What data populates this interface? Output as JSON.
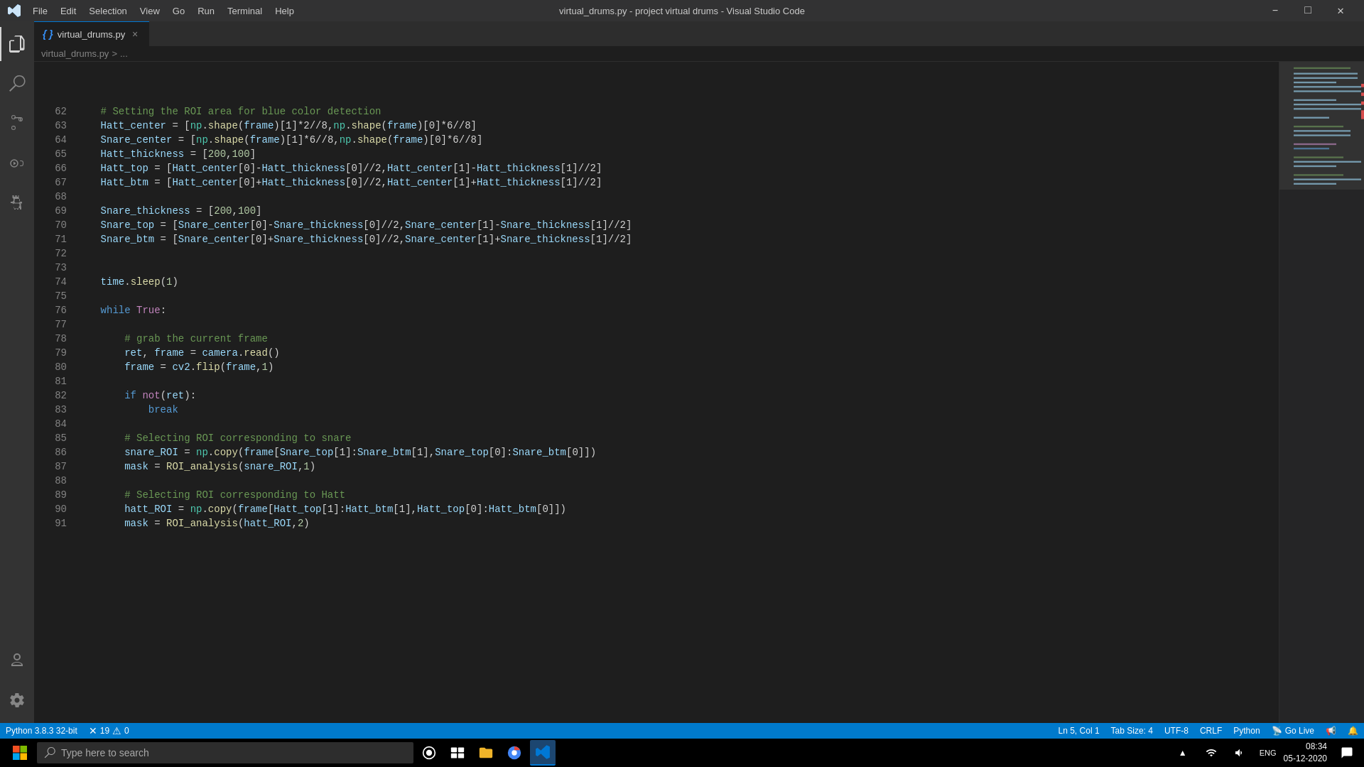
{
  "titlebar": {
    "title": "virtual_drums.py - project virtual drums - Visual Studio Code",
    "menu": [
      "File",
      "Edit",
      "Selection",
      "View",
      "Go",
      "Run",
      "Terminal",
      "Help"
    ]
  },
  "tab": {
    "filename": "virtual_drums.py",
    "close_label": "×"
  },
  "breadcrumb": {
    "path": "virtual_drums.py",
    "separator": ">",
    "more": "..."
  },
  "statusbar": {
    "python_version": "Python 3.8.3 32-bit",
    "errors": "19",
    "warnings": "0",
    "position": "Ln 5, Col 1",
    "tab_size": "Tab Size: 4",
    "encoding": "UTF-8",
    "line_ending": "CRLF",
    "language": "Python",
    "go_live": "Go Live"
  },
  "taskbar": {
    "search_placeholder": "Type here to search",
    "time": "08:34",
    "date": "05-12-2020"
  },
  "code_lines": [
    {
      "num": "62",
      "tokens": [
        {
          "t": "comment",
          "v": "    # Setting the ROI area for blue color detection"
        }
      ]
    },
    {
      "num": "63",
      "tokens": [
        {
          "t": "var",
          "v": "    Hatt_center"
        },
        {
          "t": "op",
          "v": " = ["
        },
        {
          "t": "builtin",
          "v": "np"
        },
        {
          "t": "op",
          "v": "."
        },
        {
          "t": "fn",
          "v": "shape"
        },
        {
          "t": "op",
          "v": "("
        },
        {
          "t": "var",
          "v": "frame"
        },
        {
          "t": "op",
          "v": ")[1]*2//8,"
        },
        {
          "t": "builtin",
          "v": "np"
        },
        {
          "t": "op",
          "v": "."
        },
        {
          "t": "fn",
          "v": "shape"
        },
        {
          "t": "op",
          "v": "("
        },
        {
          "t": "var",
          "v": "frame"
        },
        {
          "t": "op",
          "v": ")[0]*6//8]"
        }
      ]
    },
    {
      "num": "64",
      "tokens": [
        {
          "t": "var",
          "v": "    Snare_center"
        },
        {
          "t": "op",
          "v": " = ["
        },
        {
          "t": "builtin",
          "v": "np"
        },
        {
          "t": "op",
          "v": "."
        },
        {
          "t": "fn",
          "v": "shape"
        },
        {
          "t": "op",
          "v": "("
        },
        {
          "t": "var",
          "v": "frame"
        },
        {
          "t": "op",
          "v": ")[1]*6//8,"
        },
        {
          "t": "builtin",
          "v": "np"
        },
        {
          "t": "op",
          "v": "."
        },
        {
          "t": "fn",
          "v": "shape"
        },
        {
          "t": "op",
          "v": "("
        },
        {
          "t": "var",
          "v": "frame"
        },
        {
          "t": "op",
          "v": ")[0]*6//8]"
        }
      ]
    },
    {
      "num": "65",
      "tokens": [
        {
          "t": "var",
          "v": "    Hatt_thickness"
        },
        {
          "t": "op",
          "v": " = ["
        },
        {
          "t": "num",
          "v": "200"
        },
        {
          "t": "op",
          "v": ","
        },
        {
          "t": "num",
          "v": "100"
        },
        {
          "t": "op",
          "v": "]"
        }
      ]
    },
    {
      "num": "66",
      "tokens": [
        {
          "t": "var",
          "v": "    Hatt_top"
        },
        {
          "t": "op",
          "v": " = ["
        },
        {
          "t": "var",
          "v": "Hatt_center"
        },
        {
          "t": "op",
          "v": "[0]-"
        },
        {
          "t": "var",
          "v": "Hatt_thickness"
        },
        {
          "t": "op",
          "v": "[0]//2,"
        },
        {
          "t": "var",
          "v": "Hatt_center"
        },
        {
          "t": "op",
          "v": "[1]-"
        },
        {
          "t": "var",
          "v": "Hatt_thickness"
        },
        {
          "t": "op",
          "v": "[1]//2]"
        }
      ]
    },
    {
      "num": "67",
      "tokens": [
        {
          "t": "var",
          "v": "    Hatt_btm"
        },
        {
          "t": "op",
          "v": " = ["
        },
        {
          "t": "var",
          "v": "Hatt_center"
        },
        {
          "t": "op",
          "v": "[0]+"
        },
        {
          "t": "var",
          "v": "Hatt_thickness"
        },
        {
          "t": "op",
          "v": "[0]//2,"
        },
        {
          "t": "var",
          "v": "Hatt_center"
        },
        {
          "t": "op",
          "v": "[1]+"
        },
        {
          "t": "var",
          "v": "Hatt_thickness"
        },
        {
          "t": "op",
          "v": "[1]//2]"
        }
      ]
    },
    {
      "num": "68",
      "tokens": []
    },
    {
      "num": "69",
      "tokens": [
        {
          "t": "var",
          "v": "    Snare_thickness"
        },
        {
          "t": "op",
          "v": " = ["
        },
        {
          "t": "num",
          "v": "200"
        },
        {
          "t": "op",
          "v": ","
        },
        {
          "t": "num",
          "v": "100"
        },
        {
          "t": "op",
          "v": "]"
        }
      ]
    },
    {
      "num": "70",
      "tokens": [
        {
          "t": "var",
          "v": "    Snare_top"
        },
        {
          "t": "op",
          "v": " = ["
        },
        {
          "t": "var",
          "v": "Snare_center"
        },
        {
          "t": "op",
          "v": "[0]-"
        },
        {
          "t": "var",
          "v": "Snare_thickness"
        },
        {
          "t": "op",
          "v": "[0]//2,"
        },
        {
          "t": "var",
          "v": "Snare_center"
        },
        {
          "t": "op",
          "v": "[1]-"
        },
        {
          "t": "var",
          "v": "Snare_thickness"
        },
        {
          "t": "op",
          "v": "[1]//2]"
        }
      ]
    },
    {
      "num": "71",
      "tokens": [
        {
          "t": "var",
          "v": "    Snare_btm"
        },
        {
          "t": "op",
          "v": " = ["
        },
        {
          "t": "var",
          "v": "Snare_center"
        },
        {
          "t": "op",
          "v": "[0]+"
        },
        {
          "t": "var",
          "v": "Snare_thickness"
        },
        {
          "t": "op",
          "v": "[0]//2,"
        },
        {
          "t": "var",
          "v": "Snare_center"
        },
        {
          "t": "op",
          "v": "[1]+"
        },
        {
          "t": "var",
          "v": "Snare_thickness"
        },
        {
          "t": "op",
          "v": "[1]//2]"
        }
      ]
    },
    {
      "num": "72",
      "tokens": []
    },
    {
      "num": "73",
      "tokens": []
    },
    {
      "num": "74",
      "tokens": [
        {
          "t": "var",
          "v": "    time"
        },
        {
          "t": "op",
          "v": "."
        },
        {
          "t": "fn",
          "v": "sleep"
        },
        {
          "t": "op",
          "v": "("
        },
        {
          "t": "num",
          "v": "1"
        },
        {
          "t": "op",
          "v": ")"
        }
      ]
    },
    {
      "num": "75",
      "tokens": []
    },
    {
      "num": "76",
      "tokens": [
        {
          "t": "kw-blue",
          "v": "    while"
        },
        {
          "t": "kw",
          "v": " True"
        },
        {
          "t": "op",
          "v": ":"
        }
      ]
    },
    {
      "num": "77",
      "tokens": []
    },
    {
      "num": "78",
      "tokens": [
        {
          "t": "comment",
          "v": "        # grab the current frame"
        }
      ]
    },
    {
      "num": "79",
      "tokens": [
        {
          "t": "var",
          "v": "        ret"
        },
        {
          "t": "op",
          "v": ", "
        },
        {
          "t": "var",
          "v": "frame"
        },
        {
          "t": "op",
          "v": " = "
        },
        {
          "t": "var",
          "v": "camera"
        },
        {
          "t": "op",
          "v": "."
        },
        {
          "t": "fn",
          "v": "read"
        },
        {
          "t": "op",
          "v": "()"
        }
      ]
    },
    {
      "num": "80",
      "tokens": [
        {
          "t": "var",
          "v": "        frame"
        },
        {
          "t": "op",
          "v": " = "
        },
        {
          "t": "var",
          "v": "cv2"
        },
        {
          "t": "op",
          "v": "."
        },
        {
          "t": "fn",
          "v": "flip"
        },
        {
          "t": "op",
          "v": "("
        },
        {
          "t": "var",
          "v": "frame"
        },
        {
          "t": "op",
          "v": ","
        },
        {
          "t": "num",
          "v": "1"
        },
        {
          "t": "op",
          "v": ")"
        }
      ]
    },
    {
      "num": "81",
      "tokens": []
    },
    {
      "num": "82",
      "tokens": [
        {
          "t": "kw-blue",
          "v": "        if "
        },
        {
          "t": "kw",
          "v": "not"
        },
        {
          "t": "op",
          "v": "("
        },
        {
          "t": "var",
          "v": "ret"
        },
        {
          "t": "op",
          "v": "):"
        }
      ]
    },
    {
      "num": "83",
      "tokens": [
        {
          "t": "kw-blue",
          "v": "            break"
        }
      ]
    },
    {
      "num": "84",
      "tokens": []
    },
    {
      "num": "85",
      "tokens": [
        {
          "t": "comment",
          "v": "        # Selecting ROI corresponding to snare"
        }
      ]
    },
    {
      "num": "86",
      "tokens": [
        {
          "t": "var",
          "v": "        snare_ROI"
        },
        {
          "t": "op",
          "v": " = "
        },
        {
          "t": "builtin",
          "v": "np"
        },
        {
          "t": "op",
          "v": "."
        },
        {
          "t": "fn",
          "v": "copy"
        },
        {
          "t": "op",
          "v": "("
        },
        {
          "t": "var",
          "v": "frame"
        },
        {
          "t": "op",
          "v": "["
        },
        {
          "t": "var",
          "v": "Snare_top"
        },
        {
          "t": "op",
          "v": "[1]:"
        },
        {
          "t": "var",
          "v": "Snare_btm"
        },
        {
          "t": "op",
          "v": "[1],"
        },
        {
          "t": "var",
          "v": "Snare_top"
        },
        {
          "t": "op",
          "v": "[0]:"
        },
        {
          "t": "var",
          "v": "Snare_btm"
        },
        {
          "t": "op",
          "v": "[0]])"
        }
      ]
    },
    {
      "num": "87",
      "tokens": [
        {
          "t": "var",
          "v": "        mask"
        },
        {
          "t": "op",
          "v": " = "
        },
        {
          "t": "fn",
          "v": "ROI_analysis"
        },
        {
          "t": "op",
          "v": "("
        },
        {
          "t": "var",
          "v": "snare_ROI"
        },
        {
          "t": "op",
          "v": ","
        },
        {
          "t": "num",
          "v": "1"
        },
        {
          "t": "op",
          "v": ")"
        }
      ]
    },
    {
      "num": "88",
      "tokens": []
    },
    {
      "num": "89",
      "tokens": [
        {
          "t": "comment",
          "v": "        # Selecting ROI corresponding to Hatt"
        }
      ]
    },
    {
      "num": "90",
      "tokens": [
        {
          "t": "var",
          "v": "        hatt_ROI"
        },
        {
          "t": "op",
          "v": " = "
        },
        {
          "t": "builtin",
          "v": "np"
        },
        {
          "t": "op",
          "v": "."
        },
        {
          "t": "fn",
          "v": "copy"
        },
        {
          "t": "op",
          "v": "("
        },
        {
          "t": "var",
          "v": "frame"
        },
        {
          "t": "op",
          "v": "["
        },
        {
          "t": "var",
          "v": "Hatt_top"
        },
        {
          "t": "op",
          "v": "[1]:"
        },
        {
          "t": "var",
          "v": "Hatt_btm"
        },
        {
          "t": "op",
          "v": "[1],"
        },
        {
          "t": "var",
          "v": "Hatt_top"
        },
        {
          "t": "op",
          "v": "[0]:"
        },
        {
          "t": "var",
          "v": "Hatt_btm"
        },
        {
          "t": "op",
          "v": "[0]])"
        }
      ]
    },
    {
      "num": "91",
      "tokens": [
        {
          "t": "var",
          "v": "        mask"
        },
        {
          "t": "op",
          "v": " = "
        },
        {
          "t": "fn",
          "v": "ROI_analysis"
        },
        {
          "t": "op",
          "v": "("
        },
        {
          "t": "var",
          "v": "hatt_ROI"
        },
        {
          "t": "op",
          "v": ","
        },
        {
          "t": "num",
          "v": "2"
        },
        {
          "t": "op",
          "v": ")"
        }
      ]
    }
  ]
}
